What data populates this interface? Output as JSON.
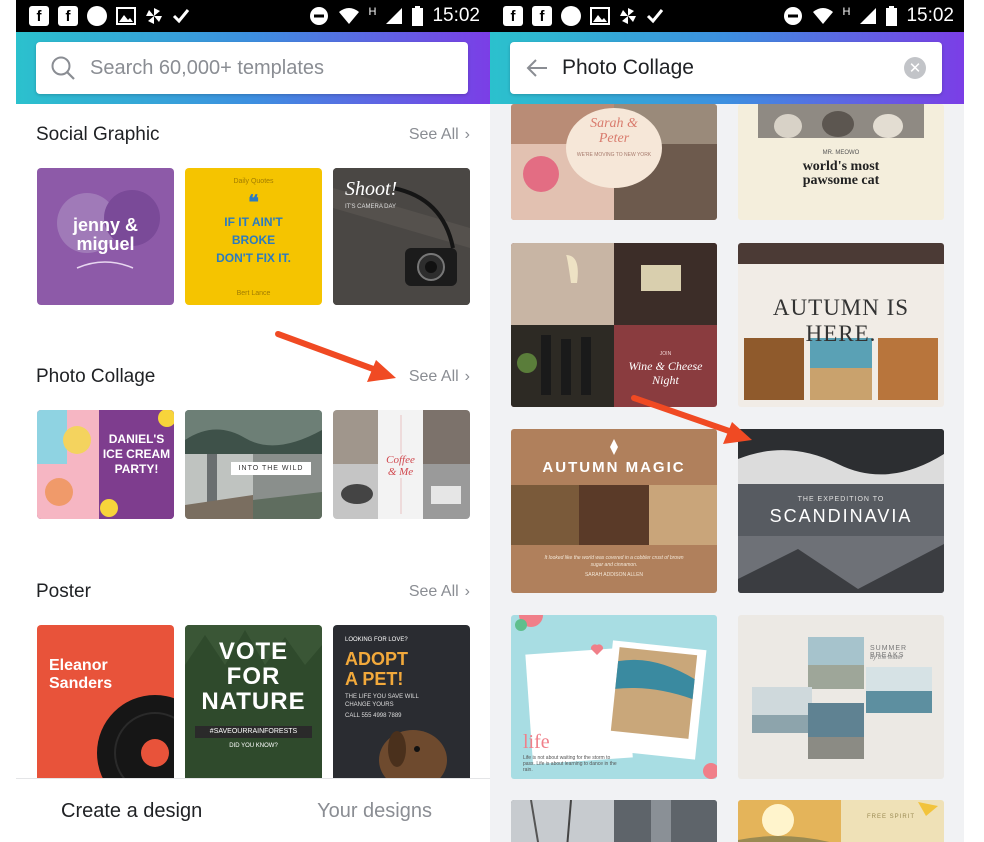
{
  "status_bar": {
    "time": "15:02",
    "network_letter": "H"
  },
  "left_screen": {
    "search": {
      "placeholder": "Search 60,000+ templates"
    },
    "sections": [
      {
        "title": "Social Graphic",
        "see_all": "See All",
        "tiles": [
          {
            "lines": [
              "jenny &",
              "miguel"
            ],
            "color": "#8d5aa8"
          },
          {
            "lines": [
              "IF IT AIN'T",
              "BROKE",
              "DON'T FIX IT."
            ],
            "small_top": "Daily Quotes",
            "small_bottom": "Bert Lance",
            "color": "#f5c400"
          },
          {
            "lines": [
              "Shoot!"
            ],
            "small": "IT'S CAMERA DAY",
            "color": "#3b3a38"
          }
        ]
      },
      {
        "title": "Photo Collage",
        "see_all": "See All",
        "tiles": [
          {
            "lines": [
              "DANIEL'S",
              "ICE CREAM",
              "PARTY!"
            ],
            "color": "#7e3d8e"
          },
          {
            "lines": [
              "INTO THE WILD"
            ],
            "color": "#5d6e66"
          },
          {
            "lines": [
              "Coffee",
              "& Me"
            ],
            "color": "#9b9b9b"
          }
        ]
      },
      {
        "title": "Poster",
        "see_all": "See All",
        "tiles": [
          {
            "lines": [
              "Eleanor",
              "Sanders"
            ],
            "color": "#e8533a"
          },
          {
            "lines": [
              "VOTE",
              "FOR",
              "NATURE"
            ],
            "small": "#SAVEOURRAINFORESTS",
            "small_bottom": "DID YOU KNOW?",
            "color": "#3f5e3a"
          },
          {
            "lines": [
              "ADOPT",
              "A PET!"
            ],
            "small_top": "LOOKING FOR LOVE?",
            "small": "THE LIFE YOU SAVE WILL CHANGE YOURS",
            "small_bottom": "CALL 555 4998 7889",
            "color": "#2a2c31"
          }
        ]
      }
    ],
    "bottom_nav": {
      "create": "Create a design",
      "yours": "Your designs"
    }
  },
  "right_screen": {
    "search_query": "Photo Collage",
    "tiles": [
      {
        "lines": [
          "Sarah &",
          "Peter"
        ],
        "small": "WE'RE MOVING TO NEW YORK",
        "color": "#cfa38c"
      },
      {
        "lines": [
          "world's most",
          "pawsome cat"
        ],
        "small_top": "MR. MEOWO",
        "color": "#f4eedc"
      },
      {
        "lines": [
          "Wine & Cheese",
          "Night"
        ],
        "small_top": "JOIN",
        "color": "#8a3c3f"
      },
      {
        "lines": [
          "AUTUMN IS HERE."
        ],
        "color": "#f1ece6"
      },
      {
        "lines": [
          "AUTUMN MAGIC"
        ],
        "small": "It looked like the world was covered in a cobbler crust of brown sugar and cinnamon.",
        "small_bottom": "SARAH ADDISON ALLEN",
        "color": "#b0805c"
      },
      {
        "lines": [
          "SCANDINAVIA"
        ],
        "small_top": "THE EXPEDITION TO",
        "color": "#4a4d52"
      },
      {
        "lines": [
          "life"
        ],
        "small": "Life is not about waiting for the storm to pass. Life is about learning to dance in the rain.",
        "color": "#a8dde3"
      },
      {
        "lines": [
          "SUMMER BREAKS"
        ],
        "small": "by the water",
        "color": "#ece9e4"
      },
      {
        "lines": [],
        "color": "#7c8288"
      },
      {
        "lines": [
          "FREE SPIRIT"
        ],
        "color": "#efe1b7"
      }
    ]
  },
  "colors": {
    "accent_arrow": "#f04a23",
    "gradient_start": "#2bc1cd",
    "gradient_end": "#7b3ee6",
    "see_all_gray": "#8a8d93"
  }
}
